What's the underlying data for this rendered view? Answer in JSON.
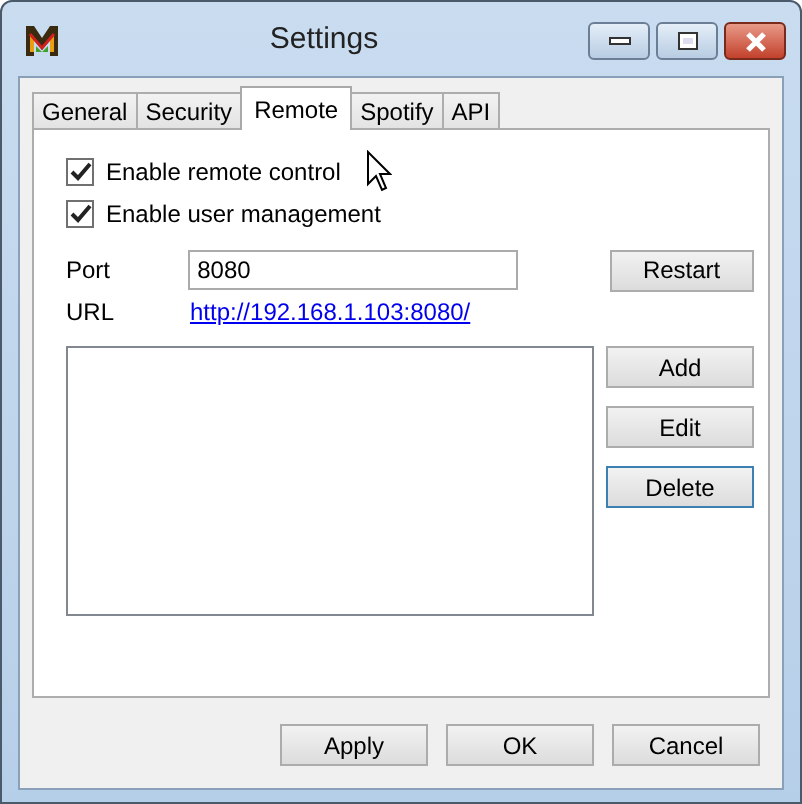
{
  "window": {
    "title": "Settings"
  },
  "tabs": [
    {
      "label": "General",
      "selected": false
    },
    {
      "label": "Security",
      "selected": false
    },
    {
      "label": "Remote",
      "selected": true
    },
    {
      "label": "Spotify",
      "selected": false
    },
    {
      "label": "API",
      "selected": false
    }
  ],
  "checkboxes": [
    {
      "label": "Enable remote control",
      "checked": true
    },
    {
      "label": "Enable user management",
      "checked": true
    }
  ],
  "port": {
    "label": "Port",
    "value": "8080"
  },
  "restart_button": "Restart",
  "url": {
    "label": "URL",
    "link": "http://192.168.1.103:8080/"
  },
  "list_buttons": [
    {
      "label": "Add",
      "focused": false
    },
    {
      "label": "Edit",
      "focused": false
    },
    {
      "label": "Delete",
      "focused": true
    }
  ],
  "dialog_buttons": [
    "Apply",
    "OK",
    "Cancel"
  ]
}
